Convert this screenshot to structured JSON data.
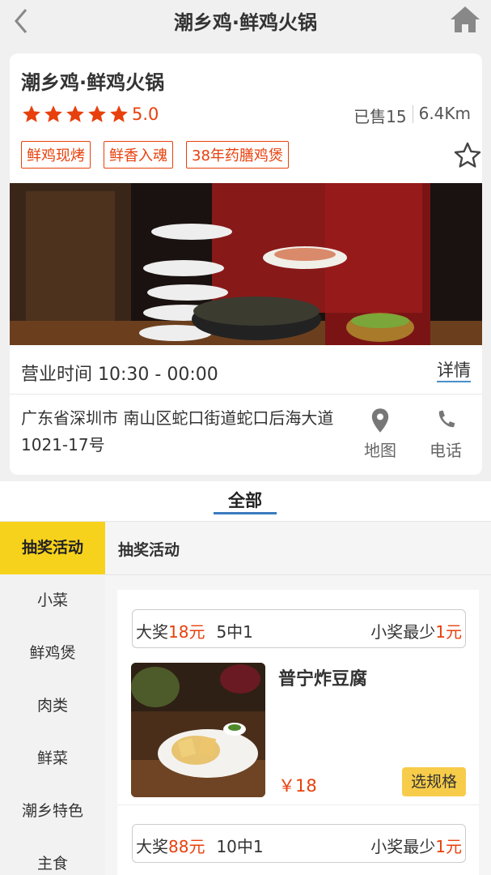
{
  "header": {
    "title": "潮乡鸡·鲜鸡火锅"
  },
  "store": {
    "name": "潮乡鸡·鲜鸡火锅",
    "rating": "5.0",
    "stars": 5,
    "sold": "已售15",
    "distance": "6.4Km",
    "tags": [
      "鲜鸡现烤",
      "鲜香入魂",
      "38年药膳鸡煲"
    ],
    "hours": "营业时间 10:30 - 00:00",
    "detail_label": "详情",
    "address": "广东省深圳市 南山区蛇口街道蛇口后海大道1021-17号",
    "map_label": "地图",
    "phone_label": "电话"
  },
  "tabs": {
    "all": "全部"
  },
  "sidebar": {
    "items": [
      "抽奖活动",
      "小菜",
      "鲜鸡煲",
      "肉类",
      "鲜菜",
      "潮乡特色",
      "主食"
    ],
    "active_index": 0
  },
  "content": {
    "section_title": "抽奖活动",
    "prize1": {
      "big_label": "大奖",
      "big_value": "18元",
      "ratio": "5中1",
      "small_label": "小奖最少",
      "small_value": "1元"
    },
    "dish": {
      "name": "普宁炸豆腐",
      "price": "￥18",
      "button": "选规格"
    },
    "prize2": {
      "big_label": "大奖",
      "big_value": "88元",
      "ratio": "10中1",
      "small_label": "小奖最少",
      "small_value": "1元"
    }
  },
  "colors": {
    "accent": "#e8400c",
    "active_tab": "#f7d21c",
    "button": "#f7cc4a",
    "link": "#3a7bbf"
  }
}
